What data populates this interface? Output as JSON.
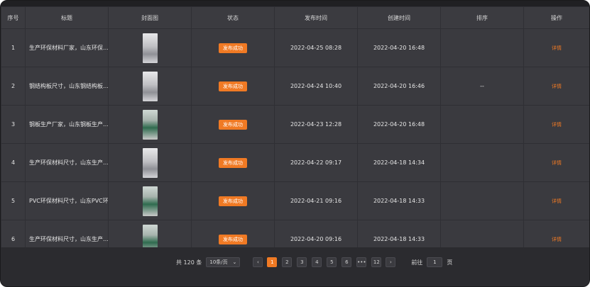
{
  "table": {
    "headers": [
      "序号",
      "标题",
      "封面图",
      "状态",
      "发布时间",
      "创建时间",
      "排序",
      "操作"
    ],
    "rows": [
      {
        "index": "1",
        "title": "生产环保材料厂家，山东环保…",
        "thumb": "light",
        "status": "发布成功",
        "publish_time": "2022-04-25 08:28",
        "created_time": "2022-04-20 16:48",
        "sort": "",
        "action": "详情"
      },
      {
        "index": "2",
        "title": "钢结构板尺寸，山东钢结构板…",
        "thumb": "light",
        "status": "发布成功",
        "publish_time": "2022-04-24 10:40",
        "created_time": "2022-04-20 16:46",
        "sort": "--",
        "action": "详情"
      },
      {
        "index": "3",
        "title": "钢板生产厂家，山东钢板生产…",
        "thumb": "green",
        "status": "发布成功",
        "publish_time": "2022-04-23 12:28",
        "created_time": "2022-04-20 16:48",
        "sort": "",
        "action": "详情"
      },
      {
        "index": "4",
        "title": "生产环保材料尺寸，山东生产…",
        "thumb": "light",
        "status": "发布成功",
        "publish_time": "2022-04-22 09:17",
        "created_time": "2022-04-18 14:34",
        "sort": "",
        "action": "详情"
      },
      {
        "index": "5",
        "title": "PVC环保材料尺寸，山东PVC环…",
        "thumb": "green",
        "status": "发布成功",
        "publish_time": "2022-04-21 09:16",
        "created_time": "2022-04-18 14:33",
        "sort": "",
        "action": "详情"
      },
      {
        "index": "6",
        "title": "生产环保材料尺寸，山东生产…",
        "thumb": "green",
        "status": "发布成功",
        "publish_time": "2022-04-20 09:16",
        "created_time": "2022-04-18 14:33",
        "sort": "",
        "action": "详情"
      }
    ]
  },
  "pagination": {
    "total_text": "共 120 条",
    "page_size": "10条/页",
    "prev_icon": "‹",
    "pages": [
      "1",
      "2",
      "3",
      "4",
      "5",
      "6",
      "•••",
      "12"
    ],
    "active_page": "1",
    "next_icon": "›",
    "goto_label": "前往",
    "goto_value": "1",
    "goto_suffix": "页"
  },
  "colors": {
    "accent": "#f07a24",
    "bg": "#2b2b2f",
    "table": "#3a3a3f"
  }
}
